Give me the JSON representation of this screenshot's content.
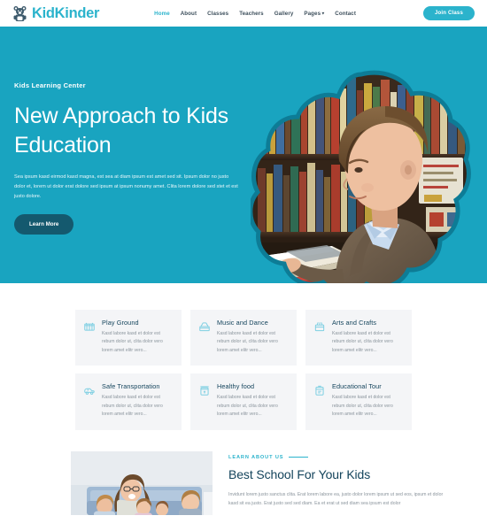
{
  "header": {
    "brand_name": "KidKinder",
    "brand_icon": "bear-logo-icon",
    "nav": [
      {
        "label": "Home",
        "active": true
      },
      {
        "label": "About",
        "active": false
      },
      {
        "label": "Classes",
        "active": false
      },
      {
        "label": "Teachers",
        "active": false
      },
      {
        "label": "Gallery",
        "active": false
      },
      {
        "label": "Pages",
        "active": false,
        "caret": "▾"
      },
      {
        "label": "Contact",
        "active": false
      }
    ],
    "join_label": "Join Class"
  },
  "hero": {
    "eyebrow": "Kids Learning Center",
    "title": "New Approach to Kids Education",
    "paragraph": "Sea ipsum kasd eirmod kasd magna, est sea at diam ipsum est amet sed sit. Ipsum dolor no justo dolor et, lorem ut dolor erat dolore sed ipsum at ipsum nonumy amet. Clita lorem dolore sed stet et est justo dolore.",
    "button_label": "Learn More",
    "image_alt": "Boy reading a book at a desk in a library, cloud-shaped frame",
    "background_color": "#19a4c0",
    "button_color": "#14596e"
  },
  "features": {
    "body_text": "Kasd labore kasd et dolor est rebum dolor ut, clita dolor vero lorem amet elitr vero...",
    "cards": [
      {
        "title": "Play Ground",
        "icon": "playground-icon"
      },
      {
        "title": "Music and Dance",
        "icon": "music-dance-icon"
      },
      {
        "title": "Arts and Crafts",
        "icon": "arts-crafts-icon"
      },
      {
        "title": "Safe Transportation",
        "icon": "school-bus-icon"
      },
      {
        "title": "Healthy food",
        "icon": "healthy-food-icon"
      },
      {
        "title": "Educational Tour",
        "icon": "educational-tour-icon"
      }
    ],
    "card_background": "#f4f5f7",
    "icon_color": "#7ecfe2"
  },
  "about": {
    "kicker": "LEARN ABOUT US",
    "title": "Best School For Your Kids",
    "paragraph": "Invidunt lorem justo sanctus clita. Erat lorem labore ea, justo dolor lorem ipsum ut sed eos, ipsum et dolor kasd sit ea justo. Erat justo sed sed diam. Ea et erat ut sed diam sea ipsum est dolor",
    "image_alt": "Teacher with children sitting on a blue couch",
    "accent_color": "#2bb3cc"
  }
}
